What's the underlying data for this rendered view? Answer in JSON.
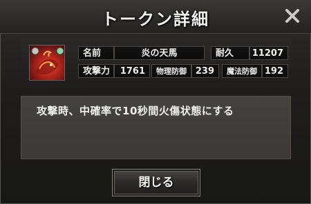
{
  "dialog": {
    "title": "トークン詳細",
    "close_button_label": "閉じる"
  },
  "token": {
    "name_label": "名前",
    "name": "炎の天馬",
    "durability_label": "耐久",
    "durability": "11207",
    "attack_label": "攻撃力",
    "attack": "1761",
    "phys_def_label": "物理防御",
    "phys_def": "239",
    "magic_def_label": "魔法防御",
    "magic_def": "192",
    "description": "攻撃時、中確率で10秒間火傷状態にする"
  },
  "icons": {
    "close": "close-x-icon",
    "portrait": "flame-pegasus-portrait"
  }
}
